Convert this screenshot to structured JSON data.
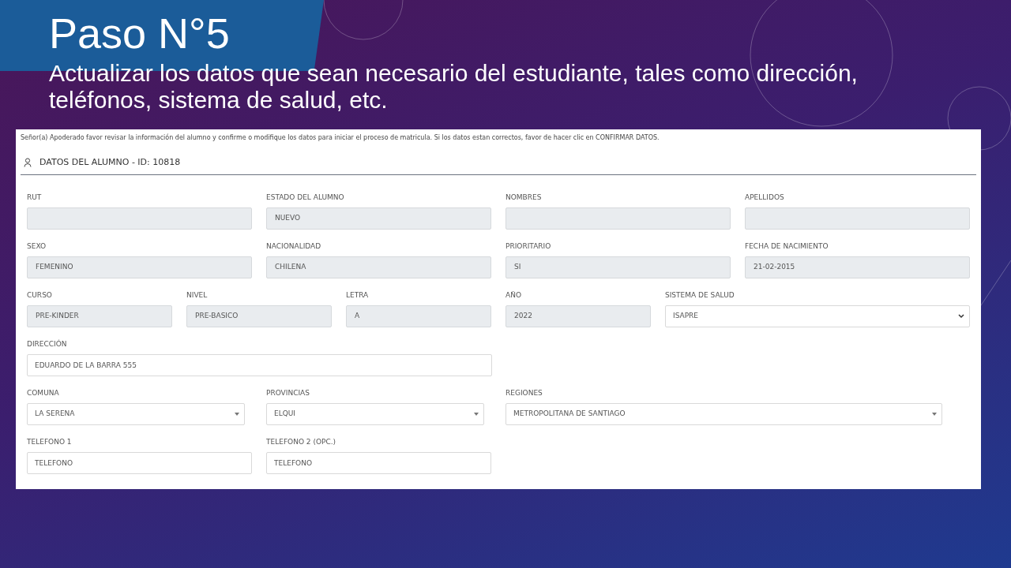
{
  "slide": {
    "title": "Paso N°5",
    "subtitle": "Actualizar los datos que sean necesario del estudiante, tales como dirección, teléfonos, sistema de salud, etc."
  },
  "form": {
    "notice": "Señor(a) Apoderado favor revisar la información del alumno y confirme o modifique los datos para iniciar el proceso de matricula. Si los datos estan correctos, favor de hacer clic en CONFIRMAR DATOS.",
    "section_title": "DATOS DEL ALUMNO - ID: 10818",
    "groups": [
      {
        "fields": [
          {
            "label": "RUT",
            "kind": "readonly"
          },
          {
            "label": "ESTADO DEL ALUMNO",
            "kind": "readonly",
            "value": "NUEVO"
          },
          {
            "label": "NOMBRES",
            "kind": "readonly"
          },
          {
            "label": "APELLIDOS",
            "kind": "readonly"
          }
        ]
      },
      {
        "fields": [
          {
            "label": "SEXO",
            "kind": "readonly",
            "value": "FEMENINO"
          },
          {
            "label": "NACIONALIDAD",
            "kind": "readonly",
            "value": "CHILENA"
          },
          {
            "label": "PRIORITARIO",
            "kind": "readonly",
            "value": "SI"
          },
          {
            "label": "FECHA DE NACIMIENTO",
            "kind": "readonly",
            "value": "21-02-2015"
          }
        ]
      },
      {
        "fields": [
          {
            "label": "CURSO",
            "kind": "readonly",
            "value": "PRE-KINDER"
          },
          {
            "label": "NIVEL",
            "kind": "readonly",
            "value": "PRE-BASICO"
          },
          {
            "label": "LETRA",
            "kind": "readonly",
            "value": "A"
          },
          {
            "label": "AÑO",
            "kind": "readonly",
            "value": "2022"
          },
          {
            "label": "SISTEMA DE SALUD",
            "kind": "select",
            "value": "ISAPRE"
          }
        ]
      },
      {
        "fields": [
          {
            "label": "DIRECCIÓN",
            "kind": "text",
            "value": "EDUARDO DE LA BARRA 555"
          }
        ]
      },
      {
        "fields": [
          {
            "label": "COMUNA",
            "kind": "dropdown",
            "value": "LA SERENA"
          },
          {
            "label": "PROVINCIAS",
            "kind": "dropdown",
            "value": "ELQUI"
          },
          {
            "label": "REGIONES",
            "kind": "dropdown",
            "value": "METROPOLITANA DE SANTIAGO"
          }
        ]
      },
      {
        "fields": [
          {
            "label": "TELEFONO 1",
            "kind": "text",
            "placeholder": "TELEFONO"
          },
          {
            "label": "TELEFONO 2 (OPC.)",
            "kind": "text",
            "placeholder": "TELEFONO"
          }
        ]
      }
    ]
  }
}
